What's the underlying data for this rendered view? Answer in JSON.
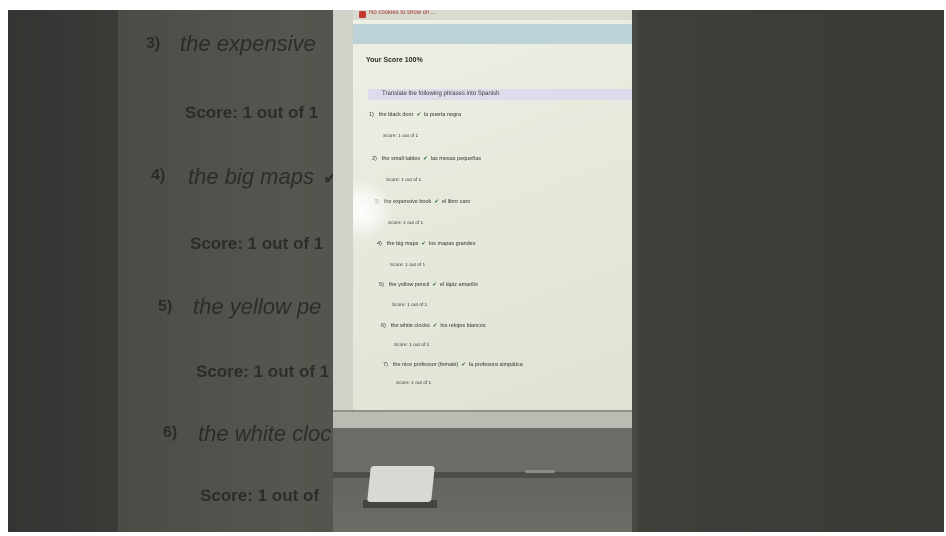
{
  "background_copy": {
    "items": [
      {
        "number": "3)",
        "phrase": "the expensive",
        "score": "Score: 1 out of 1"
      },
      {
        "number": "4)",
        "phrase": "the big maps",
        "check": "✔",
        "score": "Score: 1 out of 1"
      },
      {
        "number": "5)",
        "phrase": "the yellow pe",
        "score": "Score: 1 out of 1"
      },
      {
        "number": "6)",
        "phrase": "the white cloc",
        "score": "Score: 1 out of"
      }
    ]
  },
  "screen": {
    "top_warning": "No cookies to show on ...",
    "score_title": "Your Score 100%",
    "instruction": "Translate the following phrases into Spanish",
    "questions": [
      {
        "number": "1)",
        "english": "the black door",
        "spanish": "la puerta negra",
        "score": "Score: 1 out of 1"
      },
      {
        "number": "2)",
        "english": "the small tables",
        "spanish": "las mesas pequeñas",
        "score": "Score: 1 out of 1"
      },
      {
        "number": "3)",
        "english": "the expensive book",
        "spanish": "el libro caro",
        "score": "Score: 1 out of 1"
      },
      {
        "number": "4)",
        "english": "the big maps",
        "spanish": "los mapas grandes",
        "score": "Score: 1 out of 1"
      },
      {
        "number": "5)",
        "english": "the yellow pencil",
        "spanish": "el lápiz amarillo",
        "score": "Score: 1 out of 1"
      },
      {
        "number": "6)",
        "english": "the white clocks",
        "spanish": "los relojes blancos",
        "score": "Score: 1 out of 1"
      },
      {
        "number": "7)",
        "english": "the nice professor (female)",
        "spanish": "la profesora simpática",
        "score": "Score: 1 out of 1"
      }
    ],
    "check_glyph": "✔"
  }
}
